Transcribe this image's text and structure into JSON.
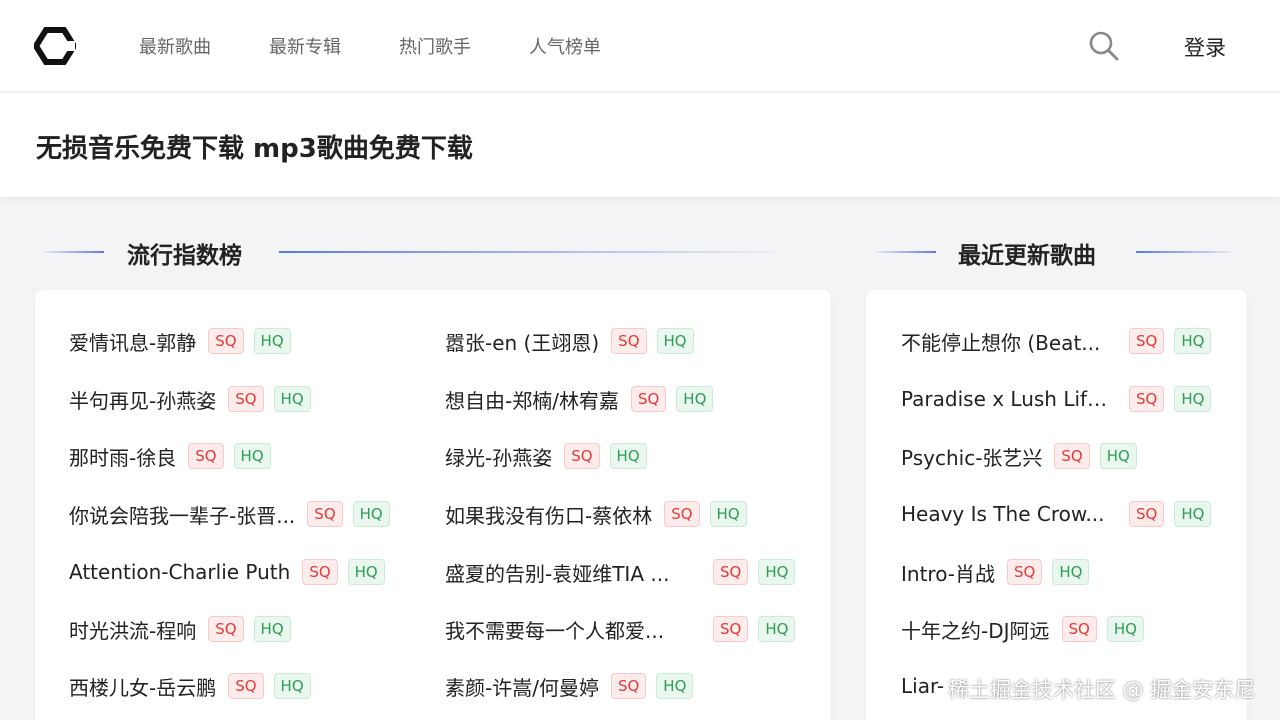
{
  "header": {
    "logo_icon": "hexagon-logo-icon",
    "nav": [
      {
        "label": "最新歌曲"
      },
      {
        "label": "最新专辑"
      },
      {
        "label": "热门歌手"
      },
      {
        "label": "人气榜单"
      }
    ],
    "search_icon": "search-icon",
    "login_label": "登录"
  },
  "banner": {
    "title": "无损音乐免费下载 mp3歌曲免费下载"
  },
  "popular": {
    "title": "流行指数榜",
    "left": [
      {
        "title": "爱情讯息-郭静",
        "sq": "SQ",
        "hq": "HQ"
      },
      {
        "title": "半句再见-孙燕姿",
        "sq": "SQ",
        "hq": "HQ"
      },
      {
        "title": "那时雨-徐良",
        "sq": "SQ",
        "hq": "HQ"
      },
      {
        "title": "你说会陪我一辈子-张晋...",
        "sq": "SQ",
        "hq": "HQ"
      },
      {
        "title": "Attention-Charlie Puth",
        "sq": "SQ",
        "hq": "HQ"
      },
      {
        "title": "时光洪流-程响",
        "sq": "SQ",
        "hq": "HQ"
      },
      {
        "title": "西楼儿女-岳云鹏",
        "sq": "SQ",
        "hq": "HQ"
      }
    ],
    "right": [
      {
        "title": "嚣张-en (王翊恩)",
        "sq": "SQ",
        "hq": "HQ"
      },
      {
        "title": "想自由-郑楠/林宥嘉",
        "sq": "SQ",
        "hq": "HQ"
      },
      {
        "title": "绿光-孙燕姿",
        "sq": "SQ",
        "hq": "HQ"
      },
      {
        "title": "如果我没有伤口-蔡依林",
        "sq": "SQ",
        "hq": "HQ"
      },
      {
        "title": "盛夏的告别-袁娅维TIA ...",
        "sq": "SQ",
        "hq": "HQ"
      },
      {
        "title": "我不需要每一个人都爱...",
        "sq": "SQ",
        "hq": "HQ"
      },
      {
        "title": "素颜-许嵩/何曼婷",
        "sq": "SQ",
        "hq": "HQ"
      }
    ]
  },
  "recent": {
    "title": "最近更新歌曲",
    "items": [
      {
        "title": "不能停止想你 (Beat...",
        "sq": "SQ",
        "hq": "HQ"
      },
      {
        "title": "Paradise x Lush Life...",
        "sq": "SQ",
        "hq": "HQ"
      },
      {
        "title": "Psychic-张艺兴",
        "sq": "SQ",
        "hq": "HQ"
      },
      {
        "title": "Heavy Is The Crow...",
        "sq": "SQ",
        "hq": "HQ"
      },
      {
        "title": "Intro-肖战",
        "sq": "SQ",
        "hq": "HQ"
      },
      {
        "title": "十年之约-DJ阿远",
        "sq": "SQ",
        "hq": "HQ"
      },
      {
        "title": "Liar-",
        "sq": "SQ",
        "hq": "HQ"
      }
    ]
  },
  "watermark": "稀土掘金技术社区 @ 掘金安东尼",
  "colors": {
    "sq_text": "#e53935",
    "hq_text": "#2e9d55",
    "accent_line": "#5b7bd5"
  }
}
